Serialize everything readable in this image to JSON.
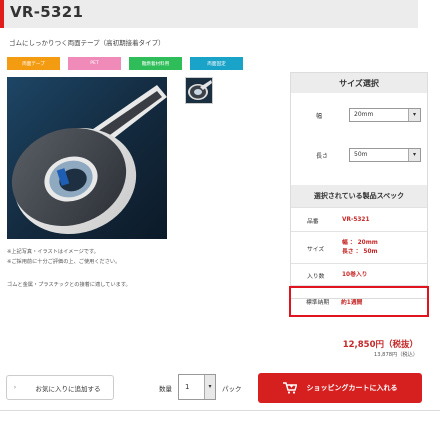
{
  "product": {
    "title": "VR-5321",
    "subtitle": "ゴムにしっかりつく両面テープ（高初期接着タイプ）",
    "accent_color": "#e21b1b"
  },
  "tags": [
    {
      "label": "両面テープ",
      "color": "#f39c12"
    },
    {
      "label": "PET",
      "color": "#f08ab8"
    },
    {
      "label": "難燃着材料用",
      "color": "#2ebd59"
    },
    {
      "label": "両面固定",
      "color": "#1aa3c8"
    }
  ],
  "notes": [
    "※上記写真・イラストはイメージです。",
    "※ご採用前に十分ご評価の上、ご使用ください。",
    "ゴムと金属・プラスチックとの接着に適しています。"
  ],
  "size_panel": {
    "heading": "サイズ選択",
    "width_label": "幅",
    "width_value": "20mm",
    "length_label": "長さ",
    "length_value": "50m"
  },
  "spec_panel": {
    "heading": "選択されている製品スペック",
    "rows": [
      {
        "key": "品番",
        "value": "VR-5321"
      },
      {
        "key": "サイズ",
        "value_line1": "幅 ： 20mm",
        "value_line2": "長さ ： 50m"
      },
      {
        "key": "入り数",
        "value": "10巻入り"
      },
      {
        "key": "標準納期",
        "value": "約1週間"
      }
    ]
  },
  "price": {
    "main": "12,850円（税抜）",
    "sub": "13,878円（税込）"
  },
  "actions": {
    "favorite_label": "お気に入りに追加する",
    "favorite_chevron": "›",
    "quantity_label": "数量",
    "quantity_value": "1",
    "unit_label": "パック",
    "cart_label": "ショッピングカートに入れる"
  },
  "icons": {
    "select_arrow": "▾",
    "cart_icon": "cart-icon"
  }
}
